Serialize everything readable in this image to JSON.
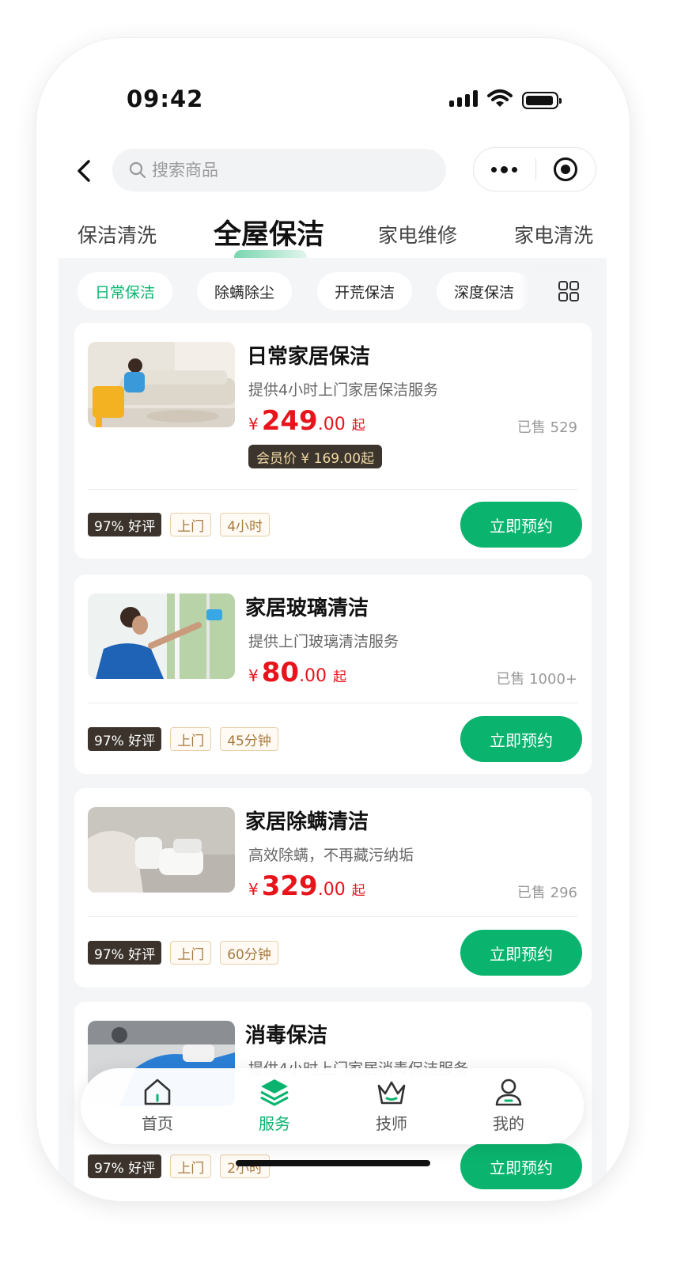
{
  "status_bar": {
    "time": "09:42"
  },
  "nav": {
    "search_placeholder": "搜索商品"
  },
  "category_tabs": [
    {
      "label": "保洁清洗",
      "active": false
    },
    {
      "label": "全屋保洁",
      "active": true
    },
    {
      "label": "家电维修",
      "active": false
    },
    {
      "label": "家电清洗",
      "active": false
    }
  ],
  "sub_tabs": [
    {
      "label": "日常保洁",
      "active": true
    },
    {
      "label": "除螨除尘",
      "active": false
    },
    {
      "label": "开荒保洁",
      "active": false
    },
    {
      "label": "深度保洁",
      "active": false
    }
  ],
  "products": [
    {
      "title": "日常家居保洁",
      "desc": "提供4小时上门家居保洁服务",
      "currency": "¥",
      "price_int": "249",
      "price_dec": ".00",
      "price_suffix": "起",
      "sold": "已售 529",
      "member_price": "会员价 ¥ 169.00起",
      "rating": "97% 好评",
      "tag1": "上门",
      "tag2": "4小时",
      "button": "立即预约"
    },
    {
      "title": "家居玻璃清洁",
      "desc": "提供上门玻璃清洁服务",
      "currency": "¥",
      "price_int": "80",
      "price_dec": ".00",
      "price_suffix": "起",
      "sold": "已售 1000+",
      "rating": "97% 好评",
      "tag1": "上门",
      "tag2": "45分钟",
      "button": "立即预约"
    },
    {
      "title": "家居除螨清洁",
      "desc": "高效除螨，不再藏污纳垢",
      "currency": "¥",
      "price_int": "329",
      "price_dec": ".00",
      "price_suffix": "起",
      "sold": "已售 296",
      "rating": "97% 好评",
      "tag1": "上门",
      "tag2": "60分钟",
      "button": "立即预约"
    },
    {
      "title": "消毒保洁",
      "desc": "提供4小时上门家居消毒保洁服务",
      "rating": "97% 好评",
      "tag1": "上门",
      "tag2": "2小时",
      "button": "立即预约"
    }
  ],
  "tabbar": [
    {
      "label": "首页",
      "icon": "home-icon",
      "active": false
    },
    {
      "label": "服务",
      "icon": "layers-icon",
      "active": true
    },
    {
      "label": "技师",
      "icon": "crown-icon",
      "active": false
    },
    {
      "label": "我的",
      "icon": "user-icon",
      "active": false
    }
  ],
  "colors": {
    "accent": "#0ab46e",
    "price": "#e8141c",
    "rating_bg": "#3c342c",
    "member_bg": "#3b352e"
  }
}
